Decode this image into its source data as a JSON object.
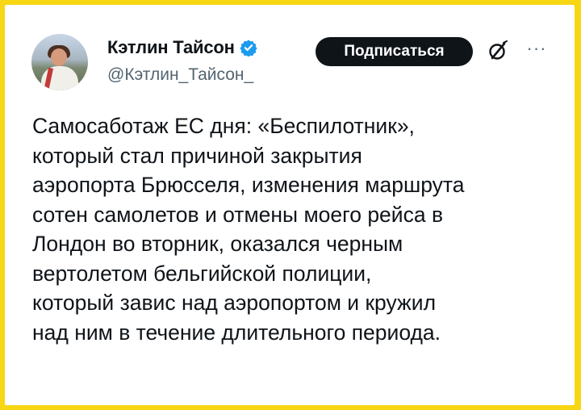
{
  "author": {
    "name": "Кэтлин Тайсон",
    "handle": "@Кэтлин_Тайсон_",
    "verified_color": "#1d9bf0"
  },
  "actions": {
    "subscribe_label": "Подписаться",
    "more_label": "···",
    "grok_icon": "grok-icon"
  },
  "tweet": {
    "lines": [
      "Самосаботаж ЕС дня: «Беспилотник»,",
      "который стал причиной закрытия",
      "аэропорта Брюсселя, изменения маршрута",
      "сотен самолетов и отмены моего рейса в",
      "Лондон во вторник, оказался черным",
      "вертолетом бельгийской полиции,",
      "который завис над аэропортом и кружил",
      "над ним в течение длительного периода."
    ]
  },
  "colors": {
    "frame": "#f7d613",
    "text": "#0f1419",
    "secondary": "#536471"
  }
}
